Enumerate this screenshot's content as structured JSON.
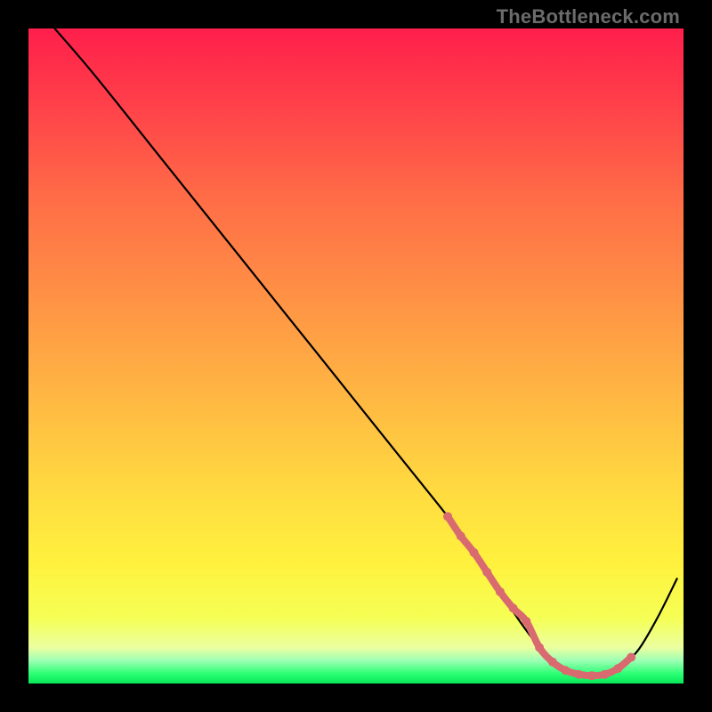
{
  "watermark": "TheBottleneck.com",
  "chart_data": {
    "type": "line",
    "title": "",
    "xlabel": "",
    "ylabel": "",
    "xlim": [
      0,
      100
    ],
    "ylim": [
      0,
      100
    ],
    "grid": false,
    "legend": false,
    "series": [
      {
        "name": "curve",
        "color": "#000000",
        "x": [
          4,
          10,
          20,
          30,
          40,
          50,
          58,
          64,
          68,
          72,
          75,
          78,
          80,
          82,
          84,
          86,
          88,
          90,
          93,
          96,
          99
        ],
        "y": [
          100,
          93,
          80.5,
          68,
          55.5,
          43,
          33,
          25.5,
          20,
          14,
          9.5,
          5.5,
          3.3,
          2.0,
          1.4,
          1.2,
          1.4,
          2.3,
          5.0,
          10,
          16
        ]
      },
      {
        "name": "highlight",
        "color": "#d96a6f",
        "x": [
          64,
          66,
          68,
          70,
          72,
          74,
          76,
          78,
          80,
          82,
          84,
          86,
          88,
          90,
          92
        ],
        "y": [
          25.5,
          22.5,
          20,
          17,
          14,
          11.5,
          9.5,
          5.5,
          3.3,
          2.0,
          1.4,
          1.2,
          1.4,
          2.3,
          4.0
        ]
      }
    ],
    "gradient_stops": [
      {
        "offset": 0.0,
        "color": "#ff1f4b"
      },
      {
        "offset": 0.1,
        "color": "#ff3b4a"
      },
      {
        "offset": 0.25,
        "color": "#ff6a47"
      },
      {
        "offset": 0.4,
        "color": "#ff8f45"
      },
      {
        "offset": 0.55,
        "color": "#ffb443"
      },
      {
        "offset": 0.7,
        "color": "#ffd940"
      },
      {
        "offset": 0.82,
        "color": "#fff23e"
      },
      {
        "offset": 0.9,
        "color": "#f5ff55"
      },
      {
        "offset": 0.945,
        "color": "#ecffa0"
      },
      {
        "offset": 0.965,
        "color": "#9cffb4"
      },
      {
        "offset": 0.985,
        "color": "#2bff74"
      },
      {
        "offset": 1.0,
        "color": "#06e756"
      }
    ]
  }
}
